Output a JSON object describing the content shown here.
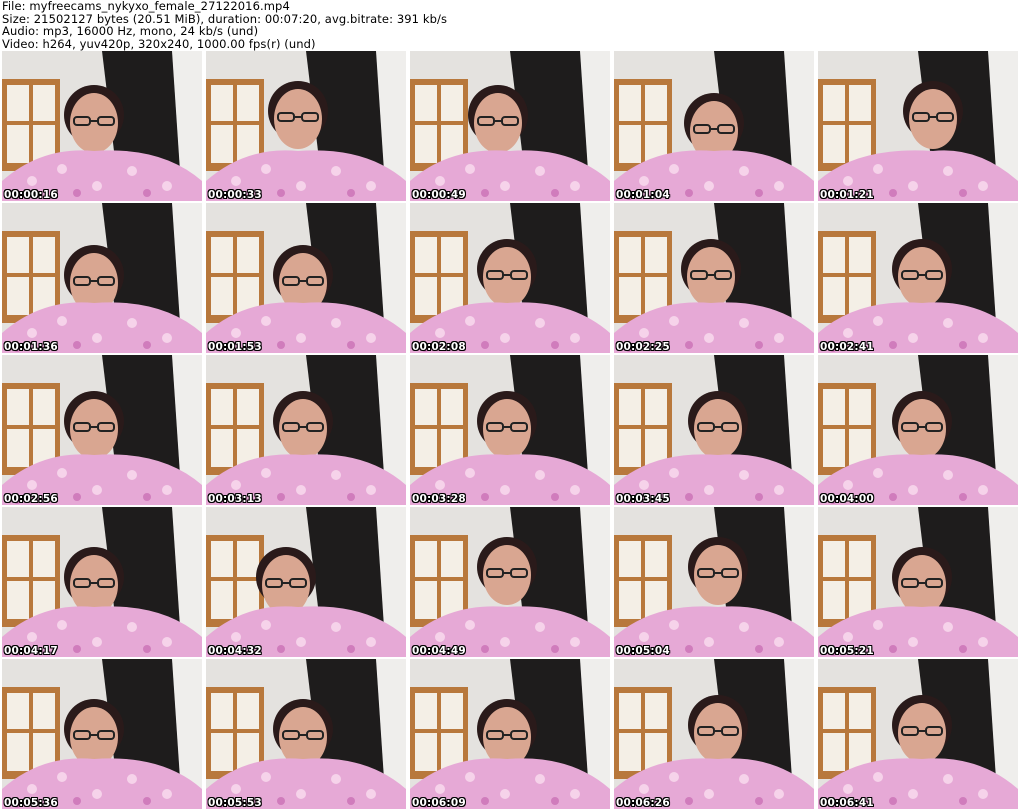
{
  "header": {
    "file": "File: myfreecams_nykyxo_female_27122016.mp4",
    "size": "Size: 21502127 bytes (20.51 MiB), duration: 00:07:20, avg.bitrate: 391 kb/s",
    "audio": "Audio: mp3, 16000 Hz, mono, 24 kb/s (und)",
    "video": "Video: h264, yuv420p, 320x240, 1000.00 fps(r) (und)"
  },
  "thumbnails": [
    {
      "timestamp": "00:00:16"
    },
    {
      "timestamp": "00:00:33"
    },
    {
      "timestamp": "00:00:49"
    },
    {
      "timestamp": "00:01:04"
    },
    {
      "timestamp": "00:01:21"
    },
    {
      "timestamp": "00:01:36"
    },
    {
      "timestamp": "00:01:53"
    },
    {
      "timestamp": "00:02:08"
    },
    {
      "timestamp": "00:02:25"
    },
    {
      "timestamp": "00:02:41"
    },
    {
      "timestamp": "00:02:56"
    },
    {
      "timestamp": "00:03:13"
    },
    {
      "timestamp": "00:03:28"
    },
    {
      "timestamp": "00:03:45"
    },
    {
      "timestamp": "00:04:00"
    },
    {
      "timestamp": "00:04:17"
    },
    {
      "timestamp": "00:04:32"
    },
    {
      "timestamp": "00:04:49"
    },
    {
      "timestamp": "00:05:04"
    },
    {
      "timestamp": "00:05:21"
    },
    {
      "timestamp": "00:05:36"
    },
    {
      "timestamp": "00:05:53"
    },
    {
      "timestamp": "00:06:09"
    },
    {
      "timestamp": "00:06:26"
    },
    {
      "timestamp": "00:06:41"
    }
  ]
}
